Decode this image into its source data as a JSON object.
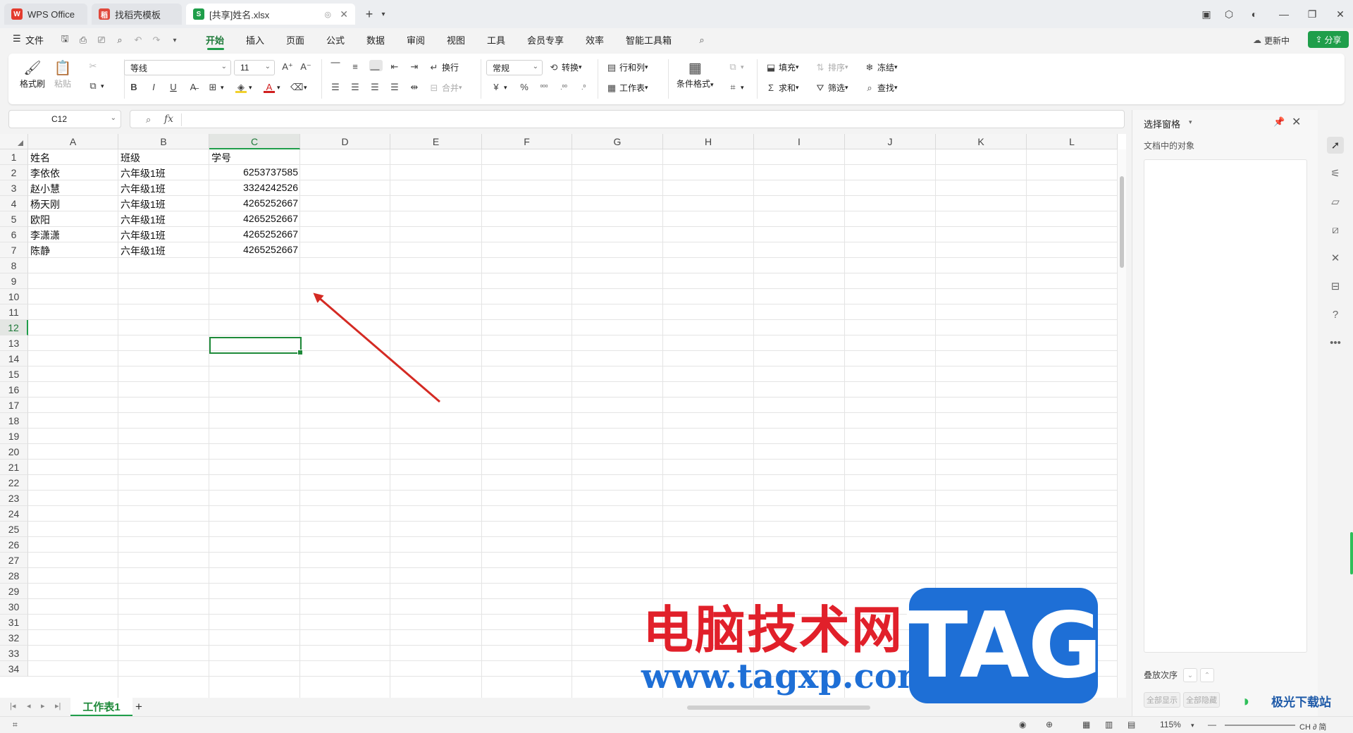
{
  "titlebar": {
    "tabs": [
      {
        "label": "WPS Office",
        "icon": "wps-logo-icon"
      },
      {
        "label": "找稻壳模板",
        "icon": "docer-icon"
      },
      {
        "label": "[共享]姓名.xlsx",
        "icon": "spreadsheet-icon"
      }
    ]
  },
  "menubar": {
    "file": "文件",
    "tabs": [
      "开始",
      "插入",
      "页面",
      "公式",
      "数据",
      "审阅",
      "视图",
      "工具",
      "会员专享",
      "效率",
      "智能工具箱"
    ],
    "active_tab": "开始",
    "update": "更新中",
    "share": "分享"
  },
  "ribbon": {
    "format_painter": "格式刷",
    "paste": "粘贴",
    "font_name": "等线",
    "font_size": "11",
    "wrap": "换行",
    "merge": "合并",
    "number_format": "常规",
    "convert": "转换",
    "row_col": "行和列",
    "worksheet": "工作表",
    "cond_format": "条件格式",
    "fill": "填充",
    "sort": "排序",
    "freeze": "冻结",
    "sum": "求和",
    "filter": "筛选",
    "find": "查找",
    "currency": "¥",
    "percent": "%"
  },
  "formula": {
    "namebox": "C12",
    "fx": "fx",
    "value": ""
  },
  "sheet": {
    "columns": [
      "A",
      "B",
      "C",
      "D",
      "E",
      "F",
      "G",
      "H",
      "I",
      "J",
      "K",
      "L"
    ],
    "selected_column": "C",
    "rows": [
      "1",
      "2",
      "3",
      "4",
      "5",
      "6",
      "7",
      "8",
      "9",
      "10",
      "11",
      "12",
      "13",
      "14",
      "15",
      "16",
      "17",
      "18",
      "19",
      "20",
      "21",
      "22",
      "23",
      "24",
      "25",
      "26",
      "27",
      "28",
      "29",
      "30",
      "31",
      "32",
      "33",
      "34"
    ],
    "selected_row": "12",
    "data": [
      {
        "a": "姓名",
        "b": "班级",
        "c": "学号"
      },
      {
        "a": "李依依",
        "b": "六年级1班",
        "c": "6253737585"
      },
      {
        "a": "赵小慧",
        "b": "六年级1班",
        "c": "3324242526"
      },
      {
        "a": "杨天刚",
        "b": "六年级1班",
        "c": "4265252667"
      },
      {
        "a": "欧阳",
        "b": "六年级1班",
        "c": "4265252667"
      },
      {
        "a": "李潇潇",
        "b": "六年级1班",
        "c": "4265252667"
      },
      {
        "a": "陈静",
        "b": "六年级1班",
        "c": "4265252667"
      }
    ],
    "active_sheet": "工作表1"
  },
  "pane": {
    "title": "选择窗格",
    "subtitle": "文档中的对象",
    "order_label": "叠放次序",
    "show_all": "全部显示",
    "hide_all": "全部隐藏"
  },
  "statusbar": {
    "zoom": "115%",
    "ime": "CH ∂ 简"
  },
  "watermark": {
    "text": "电脑技术网",
    "url": "www.tagxp.com",
    "tag": "TAG",
    "site2": "极光下载站"
  },
  "colors": {
    "accent": "#1f9e4a",
    "selection": "#1f8a3a",
    "arrow": "#d42a23",
    "watermark_red": "#e1202a",
    "watermark_blue": "#1e6fd6"
  }
}
